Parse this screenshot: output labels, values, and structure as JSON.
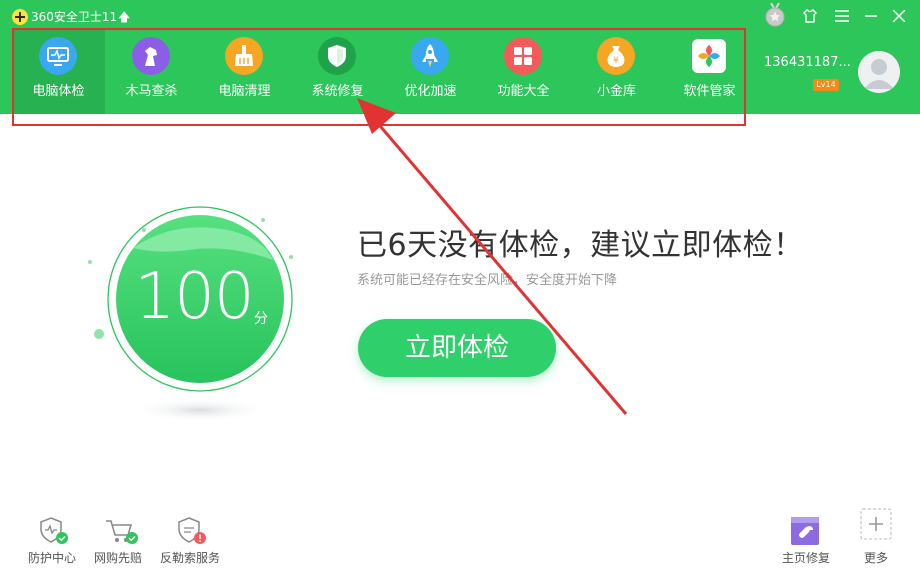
{
  "app": {
    "title": "360安全卫士11"
  },
  "nav": {
    "items": [
      {
        "label": "电脑体检",
        "icon": "monitor-check-icon",
        "color": "#3aa8f0"
      },
      {
        "label": "木马查杀",
        "icon": "horse-icon",
        "color": "#8c5ee8"
      },
      {
        "label": "电脑清理",
        "icon": "broom-icon",
        "color": "#f5a623"
      },
      {
        "label": "系统修复",
        "icon": "shield-icon",
        "color": "#1fa24a"
      },
      {
        "label": "优化加速",
        "icon": "rocket-icon",
        "color": "#3aa8f0"
      },
      {
        "label": "功能大全",
        "icon": "grid-icon",
        "color": "#f35b5b"
      },
      {
        "label": "小金库",
        "icon": "money-bag-icon",
        "color": "#f5a623"
      },
      {
        "label": "软件管家",
        "icon": "app-store-icon",
        "color": "#ffffff"
      }
    ],
    "active_index": 0
  },
  "user": {
    "name": "136431187...",
    "level": "Lv14"
  },
  "score": {
    "value": "100",
    "unit": "分"
  },
  "main": {
    "headline": "已6天没有体检，建议立即体检！",
    "subline": "系统可能已经存在安全风险，安全度开始下降",
    "button": "立即体检"
  },
  "bottom_left": [
    {
      "label": "防护中心",
      "icon": "shield-check-icon"
    },
    {
      "label": "网购先赔",
      "icon": "cart-check-icon"
    },
    {
      "label": "反勒索服务",
      "icon": "shield-alert-icon"
    }
  ],
  "bottom_right": [
    {
      "label": "主页修复",
      "icon": "wrench-icon"
    },
    {
      "label": "更多",
      "icon": "plus-icon"
    }
  ],
  "colors": {
    "brand": "#2cc65a",
    "accent": "#2fcf6b",
    "annotation": "#e23333"
  }
}
